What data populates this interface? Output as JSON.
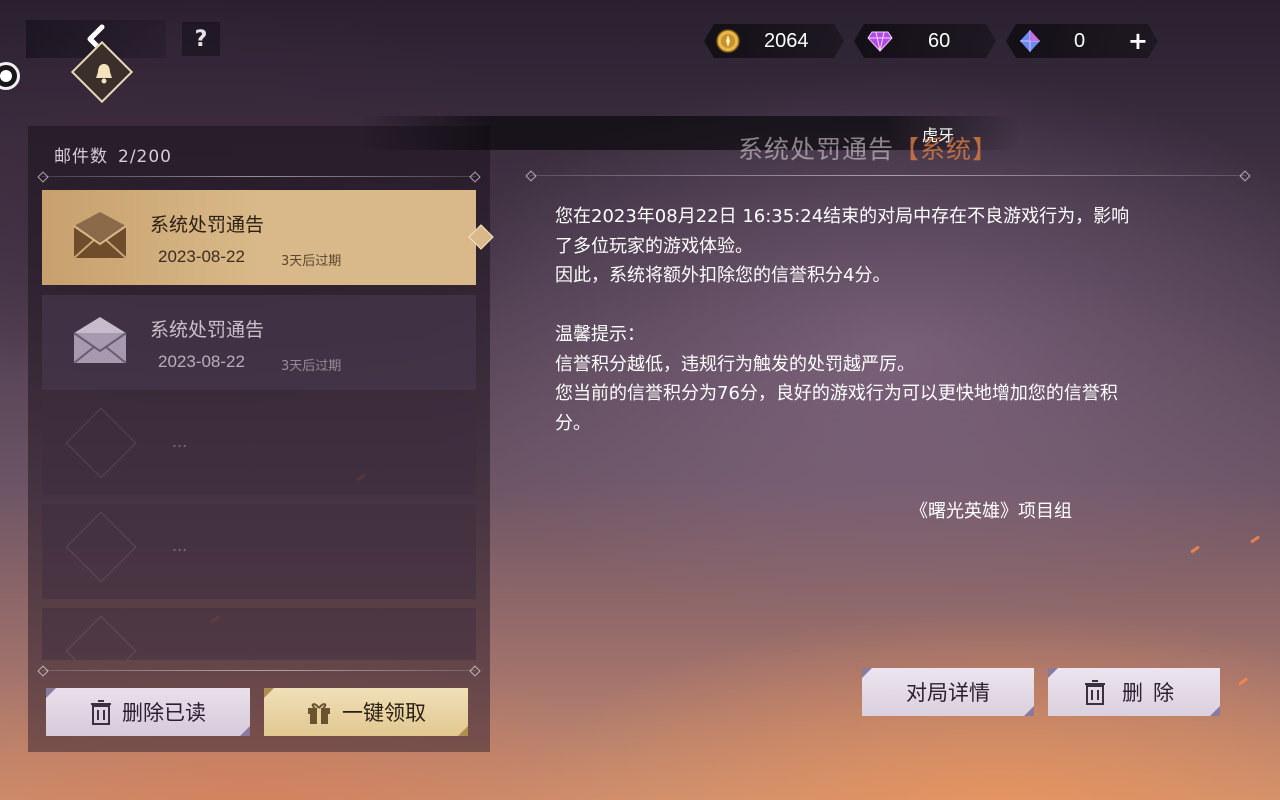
{
  "topbar": {
    "help_label": "?",
    "currencies": [
      {
        "name": "gold",
        "value": "2064"
      },
      {
        "name": "gem",
        "value": "60"
      },
      {
        "name": "crystal",
        "value": "0"
      }
    ],
    "plus_label": "+"
  },
  "mailbox": {
    "count_label": "邮件数",
    "count_value": "2/200",
    "mails": [
      {
        "title": "系统处罚通告",
        "date": "2023-08-22",
        "expire": "3天后过期",
        "state": "selected"
      },
      {
        "title": "系统处罚通告",
        "date": "2023-08-22",
        "expire": "3天后过期",
        "state": "read"
      }
    ],
    "empty_dots": "...",
    "delete_read_label": "删除已读",
    "claim_all_label": "一键领取"
  },
  "detail": {
    "watermark": "虎牙",
    "heading": "系统处罚通告",
    "heading_tag": "【系统】",
    "body_lines": [
      "您在2023年08月22日 16:35:24结束的对局中存在不良游戏行为，影响",
      "了多位玩家的游戏体验。",
      "因此，系统将额外扣除您的信誉积分4分。",
      "",
      "温馨提示：",
      "信誉积分越低，违规行为触发的处罚越严厉。",
      "您当前的信誉积分为76分，良好的游戏行为可以更快地增加您的信誉积",
      "分。"
    ],
    "signature": "《曙光英雄》项目组",
    "match_details_label": "对局详情",
    "delete_label": "删除"
  },
  "colors": {
    "selected_mail": "#d9b98a",
    "heading_tag": "#e68246"
  }
}
